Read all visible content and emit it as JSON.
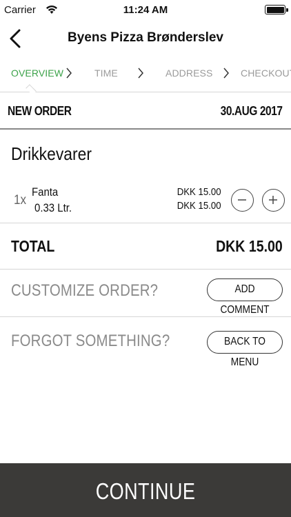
{
  "status_bar": {
    "carrier": "Carrier",
    "time": "11:24 AM"
  },
  "nav": {
    "title": "Byens Pizza Brønderslev"
  },
  "steps": [
    {
      "label": "OVERVIEW",
      "active": true
    },
    {
      "label": "TIME",
      "active": false
    },
    {
      "label": "ADDRESS",
      "active": false
    },
    {
      "label": "CHECKOUT",
      "active": false
    }
  ],
  "order": {
    "label": "NEW ORDER",
    "date": "30.AUG 2017"
  },
  "category": "Drikkevarer",
  "item": {
    "qty": "1x",
    "name": "Fanta",
    "size": "0.33 Ltr.",
    "unit_price": "DKK 15.00",
    "line_price": "DKK 15.00"
  },
  "total": {
    "label": "TOTAL",
    "amount": "DKK 15.00"
  },
  "customize": {
    "question": "CUSTOMIZE ORDER?",
    "button": "ADD COMMENT"
  },
  "forgot": {
    "question": "FORGOT SOMETHING?",
    "button": "BACK TO MENU"
  },
  "continue_label": "CONTINUE",
  "colors": {
    "active_step": "#3ca24a",
    "continue_bg": "#3b3a38"
  }
}
